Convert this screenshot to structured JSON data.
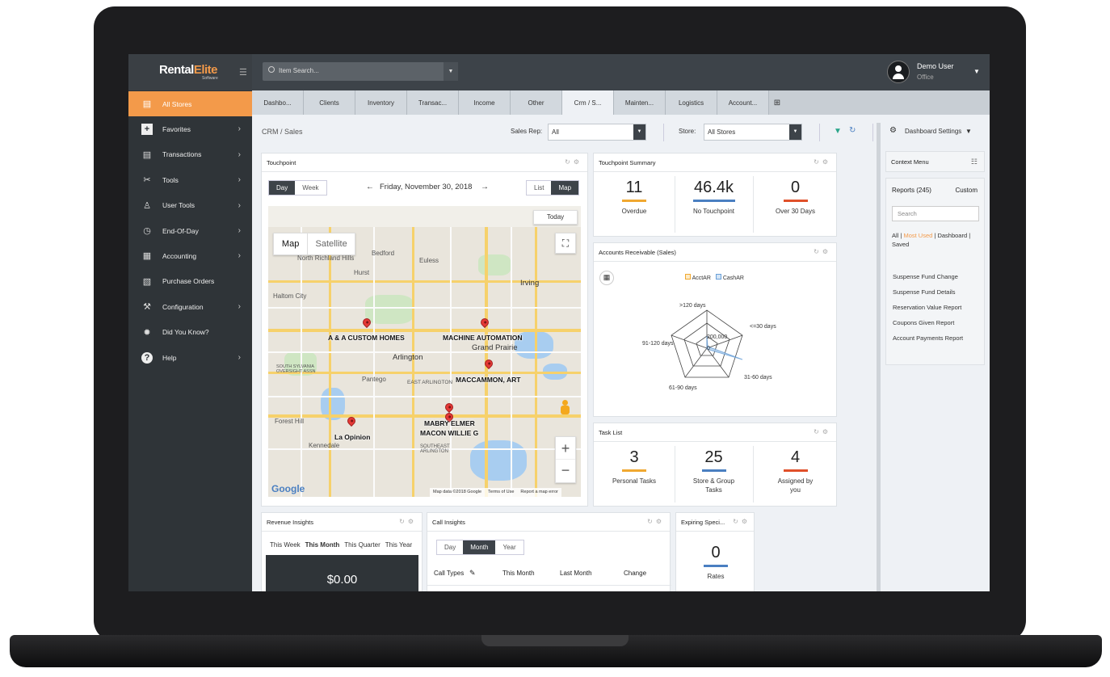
{
  "brand": {
    "name_a": "Rental",
    "name_b": "Elite",
    "sub": "Software"
  },
  "search": {
    "placeholder": "Item Search..."
  },
  "user": {
    "name": "Demo User",
    "role": "Office"
  },
  "sidebar": {
    "items": [
      {
        "label": "All Stores",
        "icon": "store-icon"
      },
      {
        "label": "Favorites",
        "icon": "plus-icon"
      },
      {
        "label": "Transactions",
        "icon": "document-icon"
      },
      {
        "label": "Tools",
        "icon": "tools-icon"
      },
      {
        "label": "User Tools",
        "icon": "user-tools-icon"
      },
      {
        "label": "End-Of-Day",
        "icon": "calendar-clock-icon"
      },
      {
        "label": "Accounting",
        "icon": "ledger-icon"
      },
      {
        "label": "Purchase Orders",
        "icon": "purchase-order-icon"
      },
      {
        "label": "Configuration",
        "icon": "wrench-icon"
      },
      {
        "label": "Did You Know?",
        "icon": "lightbulb-icon"
      },
      {
        "label": "Help",
        "icon": "help-icon"
      }
    ]
  },
  "tabs": [
    "Dashbo...",
    "Clients",
    "Inventory",
    "Transac...",
    "Income",
    "Other",
    "Crm / S...",
    "Mainten...",
    "Logistics",
    "Account..."
  ],
  "header": {
    "breadcrumb": "CRM / Sales",
    "sales_rep_label": "Sales Rep:",
    "sales_rep_value": "All",
    "store_label": "Store:",
    "store_value": "All Stores",
    "dashboard_settings": "Dashboard Settings"
  },
  "touchpoint": {
    "title": "Touchpoint",
    "day": "Day",
    "week": "Week",
    "date": "Friday, November 30, 2018",
    "list": "List",
    "map": "Map",
    "today": "Today",
    "map_tab": "Map",
    "satellite_tab": "Satellite",
    "pins": [
      "A & A CUSTOM HOMES",
      "MACHINE AUTOMATION",
      "MACCAMMON, ART",
      "MABRY ELMER",
      "MACON WILLIE G",
      "La Opinion"
    ],
    "cities": [
      "North Richland Hills",
      "Bedford",
      "Euless",
      "Hurst",
      "Haltom City",
      "Irving",
      "Grand Prairie",
      "Arlington",
      "Pantego",
      "EAST ARLINGTON",
      "Forest Hill",
      "Kennedale",
      "SOUTHEAST ARLINGTON",
      "SOUTH SYLVANIA OVERSIGHT ASSN"
    ],
    "google": "Google",
    "map_footer": [
      "Map data ©2018 Google",
      "Terms of Use",
      "Report a map error"
    ]
  },
  "touchpoint_summary": {
    "title": "Touchpoint Summary",
    "stats": [
      {
        "value": "11",
        "label": "Overdue",
        "color": "#f0a830"
      },
      {
        "value": "46.4k",
        "label": "No Touchpoint",
        "color": "#4a7fc1"
      },
      {
        "value": "0",
        "label": "Over 30 Days",
        "color": "#e0502a"
      }
    ]
  },
  "accounts_receivable": {
    "title": "Accounts Receivable (Sales)",
    "legend": [
      "AcctAR",
      "CashAR"
    ],
    "axes": [
      ">120 days",
      "<=30 days",
      "31-60 days",
      "61-90 days",
      "91-120 days"
    ],
    "rings": [
      "200,000",
      "0"
    ]
  },
  "task_list": {
    "title": "Task List",
    "stats": [
      {
        "value": "3",
        "label": "Personal Tasks",
        "color": "#f0a830"
      },
      {
        "value": "25",
        "label": "Store & Group Tasks",
        "color": "#4a7fc1"
      },
      {
        "value": "4",
        "label": "Assigned by you",
        "color": "#e0502a"
      }
    ]
  },
  "revenue_insights": {
    "title": "Revenue Insights",
    "periods": [
      "This Week",
      "This Month",
      "This Quarter",
      "This Year"
    ],
    "value": "$0.00"
  },
  "call_insights": {
    "title": "Call Insights",
    "periods": [
      "Day",
      "Month",
      "Year"
    ],
    "columns": [
      "Call Types",
      "This Month",
      "Last Month",
      "Change"
    ]
  },
  "expiring_specials": {
    "title": "Expiring Speci...",
    "value": "0",
    "label": "Rates"
  },
  "context_menu": {
    "title": "Context Menu",
    "reports_label": "Reports",
    "reports_count": "(245)",
    "custom": "Custom",
    "search_placeholder": "Search",
    "filters": [
      "All",
      "Most Used",
      "Dashboard",
      "Saved"
    ],
    "reports": [
      "Suspense Fund Change",
      "Suspense Fund Details",
      "Reservation Value Report",
      "Coupons Given Report",
      "Account Payments Report"
    ]
  },
  "colors": {
    "accent": "#f39a4a",
    "sidebar": "#2f3438",
    "topbar": "#3d4349"
  }
}
